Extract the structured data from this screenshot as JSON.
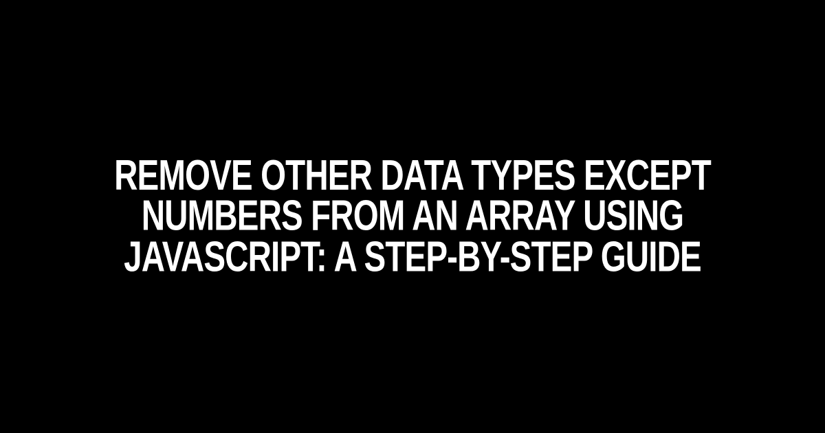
{
  "title": "Remove Other Data Types Except Numbers from an Array using JavaScript: A Step-by-Step Guide"
}
